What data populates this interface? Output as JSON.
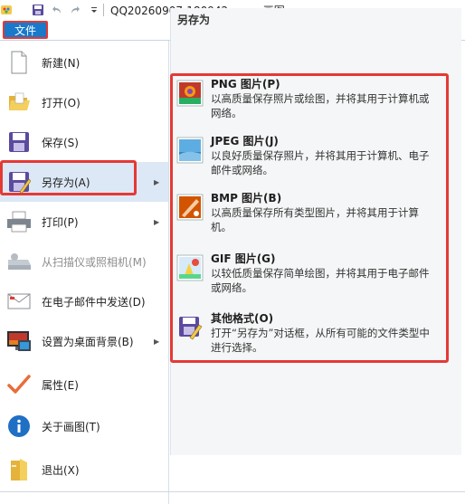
{
  "window": {
    "title": "QQ20260907-180942.png - 画图"
  },
  "ribbon": {
    "file_tab": "文件"
  },
  "menu": {
    "items": [
      {
        "label": "新建(N)",
        "icon": "new-document-icon",
        "has_submenu": false,
        "disabled": false
      },
      {
        "label": "打开(O)",
        "icon": "open-folder-icon",
        "has_submenu": false,
        "disabled": false
      },
      {
        "label": "保存(S)",
        "icon": "save-disk-icon",
        "has_submenu": false,
        "disabled": false
      },
      {
        "label": "另存为(A)",
        "icon": "save-as-icon",
        "has_submenu": true,
        "disabled": false,
        "selected": true
      },
      {
        "label": "打印(P)",
        "icon": "printer-icon",
        "has_submenu": true,
        "disabled": false
      },
      {
        "label": "从扫描仪或照相机(M)",
        "icon": "scanner-icon",
        "has_submenu": false,
        "disabled": true
      },
      {
        "label": "在电子邮件中发送(D)",
        "icon": "email-icon",
        "has_submenu": false,
        "disabled": false
      },
      {
        "label": "设置为桌面背景(B)",
        "icon": "desktop-background-icon",
        "has_submenu": true,
        "disabled": false
      },
      {
        "label": "属性(E)",
        "icon": "checkmark-icon",
        "has_submenu": false,
        "disabled": false
      },
      {
        "label": "关于画图(T)",
        "icon": "info-icon",
        "has_submenu": false,
        "disabled": false
      },
      {
        "label": "退出(X)",
        "icon": "exit-icon",
        "has_submenu": false,
        "disabled": false
      }
    ]
  },
  "submenu": {
    "title": "另存为",
    "items": [
      {
        "title": "PNG 图片(P)",
        "desc": "以高质量保存照片或绘图，并将其用于计算机或网络。",
        "icon": "png-image-icon"
      },
      {
        "title": "JPEG 图片(J)",
        "desc": "以良好质量保存照片，并将其用于计算机、电子邮件或网络。",
        "icon": "jpeg-image-icon"
      },
      {
        "title": "BMP 图片(B)",
        "desc": "以高质量保存所有类型图片，并将其用于计算机。",
        "icon": "bmp-image-icon"
      },
      {
        "title": "GIF 图片(G)",
        "desc": "以较低质量保存简单绘图，并将其用于电子邮件或网络。",
        "icon": "gif-image-icon"
      },
      {
        "title": "其他格式(O)",
        "desc": "打开“另存为”对话框，从所有可能的文件类型中进行选择。",
        "icon": "other-formats-icon"
      }
    ]
  },
  "colors": {
    "accent": "#1979ca",
    "highlight": "#e53935",
    "submenu_bg": "#f5f6f7"
  }
}
